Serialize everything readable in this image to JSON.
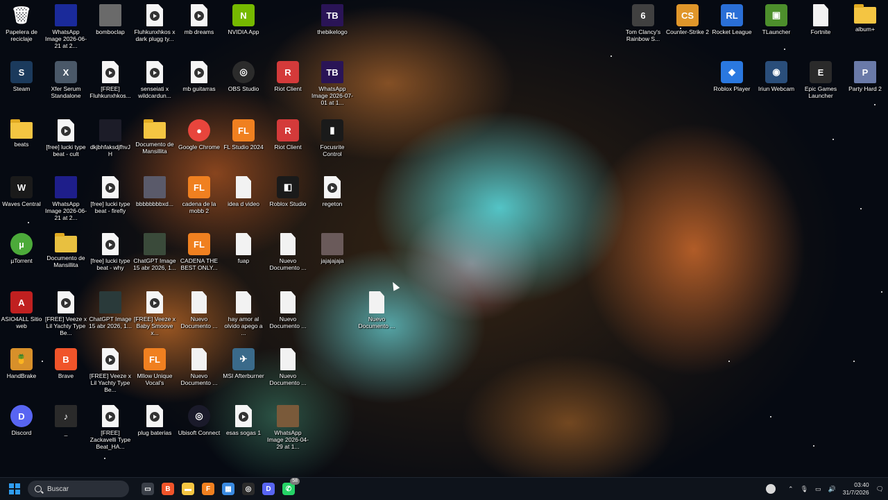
{
  "desktop": {
    "icons": [
      {
        "label": "Papelera de reciclaje",
        "kind": "bin",
        "color": "#cfe3f2",
        "glyph": "🗑"
      },
      {
        "label": "WhatsApp Image 2026-06-21 at 2...",
        "kind": "img",
        "color": "#1a2a9a",
        "glyph": ""
      },
      {
        "label": "bomboclap",
        "kind": "img",
        "color": "#6a6a6a",
        "glyph": ""
      },
      {
        "label": "Fluhkunxhkos x dark plugg ty...",
        "kind": "media",
        "color": "#f5f5f5",
        "glyph": ""
      },
      {
        "label": "mb dreams",
        "kind": "media",
        "color": "#f5f5f5",
        "glyph": ""
      },
      {
        "label": "NVIDIA App",
        "kind": "app",
        "color": "#76b900",
        "glyph": "N"
      },
      {
        "label": "thebikelogo",
        "kind": "img",
        "color": "#2a1456",
        "glyph": "TB"
      },
      {
        "label": "Tom Clancy's Rainbow S...",
        "kind": "app",
        "color": "#404040",
        "glyph": "6"
      },
      {
        "label": "Counter-Strike 2",
        "kind": "app",
        "color": "#e0962a",
        "glyph": "CS"
      },
      {
        "label": "Rocket League",
        "kind": "app",
        "color": "#2a6fd6",
        "glyph": "RL"
      },
      {
        "label": "TLauncher",
        "kind": "app",
        "color": "#4d8f2c",
        "glyph": "▣"
      },
      {
        "label": "Fortnite",
        "kind": "doc",
        "color": "#f2f2f2",
        "glyph": ""
      },
      {
        "label": "album+",
        "kind": "folder",
        "color": "#f4c542",
        "glyph": ""
      },
      {
        "label": "Steam",
        "kind": "app",
        "color": "#1b3a5c",
        "glyph": "S"
      },
      {
        "label": "Xfer Serum Standalone",
        "kind": "app",
        "color": "#4a5868",
        "glyph": "X"
      },
      {
        "label": "[FREE] Fluhkunxhkos...",
        "kind": "media",
        "color": "#f5f5f5",
        "glyph": ""
      },
      {
        "label": "senseiati x wildcardun...",
        "kind": "media",
        "color": "#f5f5f5",
        "glyph": ""
      },
      {
        "label": "mb guitarras",
        "kind": "media",
        "color": "#f5f5f5",
        "glyph": ""
      },
      {
        "label": "OBS Studio",
        "kind": "round",
        "color": "#2b2b2b",
        "glyph": "◎"
      },
      {
        "label": "Riot Client",
        "kind": "app",
        "color": "#d43a3a",
        "glyph": "R"
      },
      {
        "label": "WhatsApp Image 2026-07-01 at 1...",
        "kind": "img",
        "color": "#2a1456",
        "glyph": "TB"
      },
      {
        "label": "Roblox Player",
        "kind": "app",
        "color": "#2a78e0",
        "glyph": "◆"
      },
      {
        "label": "Iriun Webcam",
        "kind": "app",
        "color": "#2a4e7a",
        "glyph": "◉"
      },
      {
        "label": "Epic Games Launcher",
        "kind": "app",
        "color": "#2a2a2a",
        "glyph": "E"
      },
      {
        "label": "Party Hard 2",
        "kind": "img",
        "color": "#6a7aa8",
        "glyph": "P"
      },
      {
        "label": "beats",
        "kind": "folder",
        "color": "#f4c542",
        "glyph": ""
      },
      {
        "label": "[free] lucki type beat - cult",
        "kind": "media",
        "color": "#f5f5f5",
        "glyph": ""
      },
      {
        "label": "dkjbhfaksdjfhvJH",
        "kind": "img",
        "color": "#1c1c28",
        "glyph": ""
      },
      {
        "label": "Documento de Mansillita",
        "kind": "folder",
        "color": "#f4c542",
        "glyph": ""
      },
      {
        "label": "Google Chrome",
        "kind": "round",
        "color": "#e8453c",
        "glyph": "●"
      },
      {
        "label": "FL Studio 2024",
        "kind": "app",
        "color": "#f08020",
        "glyph": "FL"
      },
      {
        "label": "Riot Client",
        "kind": "app",
        "color": "#d43a3a",
        "glyph": "R"
      },
      {
        "label": "Focusrite Control",
        "kind": "app",
        "color": "#1a1a1a",
        "glyph": "▮"
      },
      {
        "label": "Waves Central",
        "kind": "app",
        "color": "#1a1a1a",
        "glyph": "W"
      },
      {
        "label": "WhatsApp Image 2026-06-21 at 2...",
        "kind": "img",
        "color": "#1e1e8a",
        "glyph": ""
      },
      {
        "label": "[free] lucki type beat - firefly",
        "kind": "media",
        "color": "#f5f5f5",
        "glyph": ""
      },
      {
        "label": "bbbbbbbbxd...",
        "kind": "img",
        "color": "#5a5a6a",
        "glyph": ""
      },
      {
        "label": "cadena de la mobb 2",
        "kind": "app",
        "color": "#f08020",
        "glyph": "FL"
      },
      {
        "label": "idea d video",
        "kind": "doc",
        "color": "#f2f2f2",
        "glyph": ""
      },
      {
        "label": "Roblox Studio",
        "kind": "app",
        "color": "#1a1a1a",
        "glyph": "◧"
      },
      {
        "label": "regeton",
        "kind": "media",
        "color": "#f5f5f5",
        "glyph": ""
      },
      {
        "label": "µTorrent",
        "kind": "round",
        "color": "#4caa3a",
        "glyph": "µ"
      },
      {
        "label": "Documento de Mansillita",
        "kind": "folder",
        "color": "#e8c040",
        "glyph": ""
      },
      {
        "label": "[free] lucki type beat - why",
        "kind": "media",
        "color": "#f5f5f5",
        "glyph": ""
      },
      {
        "label": "ChatGPT Image 15 abr 2026, 1...",
        "kind": "img",
        "color": "#3a4a3a",
        "glyph": ""
      },
      {
        "label": "CADENA THE BEST ONLY...",
        "kind": "app",
        "color": "#f08020",
        "glyph": "FL"
      },
      {
        "label": "fuap",
        "kind": "doc",
        "color": "#f2f2f2",
        "glyph": ""
      },
      {
        "label": "Nuevo Documento ...",
        "kind": "doc",
        "color": "#f2f2f2",
        "glyph": ""
      },
      {
        "label": "jajajajaja",
        "kind": "img",
        "color": "#6a5a5a",
        "glyph": ""
      },
      {
        "label": "ASIO4ALL Sitio web",
        "kind": "app",
        "color": "#c02020",
        "glyph": "A"
      },
      {
        "label": "[FREE] Veeze x Lil Yachty Type Be...",
        "kind": "media",
        "color": "#f5f5f5",
        "glyph": ""
      },
      {
        "label": "ChatGPT Image 15 abr 2026, 1...",
        "kind": "img",
        "color": "#2a3a3a",
        "glyph": ""
      },
      {
        "label": "[FREE] Veeze x Baby Smoove x...",
        "kind": "media",
        "color": "#f5f5f5",
        "glyph": ""
      },
      {
        "label": "Nuevo Documento ...",
        "kind": "doc",
        "color": "#f2f2f2",
        "glyph": ""
      },
      {
        "label": "hay amor al olvido apego a ...",
        "kind": "doc",
        "color": "#f2f2f2",
        "glyph": ""
      },
      {
        "label": "Nuevo Documento ...",
        "kind": "doc",
        "color": "#f2f2f2",
        "glyph": ""
      },
      {
        "label": "Nuevo Documento ...",
        "kind": "doc",
        "color": "#f2f2f2",
        "glyph": ""
      },
      {
        "label": "HandBrake",
        "kind": "app",
        "color": "#d8902a",
        "glyph": "🍍"
      },
      {
        "label": "Brave",
        "kind": "app",
        "color": "#f0542a",
        "glyph": "B"
      },
      {
        "label": "[FREE] Veeze x Lil Yachty Type Be...",
        "kind": "media",
        "color": "#f5f5f5",
        "glyph": ""
      },
      {
        "label": "Mllow Unique Vocal's",
        "kind": "app",
        "color": "#f08020",
        "glyph": "FL"
      },
      {
        "label": "Nuevo Documento ...",
        "kind": "doc",
        "color": "#f2f2f2",
        "glyph": ""
      },
      {
        "label": "MSI Afterburner",
        "kind": "app",
        "color": "#3a6a8a",
        "glyph": "✈"
      },
      {
        "label": "Nuevo Documento ...",
        "kind": "doc",
        "color": "#f2f2f2",
        "glyph": ""
      },
      {
        "label": "Discord",
        "kind": "round",
        "color": "#5865f2",
        "glyph": "D"
      },
      {
        "label": "_",
        "kind": "img",
        "color": "#2a2a2a",
        "glyph": "♪"
      },
      {
        "label": "[FREE] Zackavelli Type Beat_HA...",
        "kind": "media",
        "color": "#f5f5f5",
        "glyph": ""
      },
      {
        "label": "plug baterias",
        "kind": "media",
        "color": "#f5f5f5",
        "glyph": ""
      },
      {
        "label": "Ubisoft Connect",
        "kind": "round",
        "color": "#1a1a2a",
        "glyph": "◎"
      },
      {
        "label": "esas sogas 1",
        "kind": "media",
        "color": "#f5f5f5",
        "glyph": ""
      },
      {
        "label": "WhatsApp Image 2026-04-29 at 1...",
        "kind": "img",
        "color": "#7a5a3a",
        "glyph": ""
      }
    ]
  },
  "taskbar": {
    "search_placeholder": "Buscar",
    "whatsapp_badge": "58",
    "time": "03:40",
    "date": "31/7/2026",
    "pinned": [
      {
        "name": "task-view",
        "color": "#3a3f48",
        "glyph": "▭"
      },
      {
        "name": "brave",
        "color": "#f0542a",
        "glyph": "B"
      },
      {
        "name": "file-explorer",
        "color": "#f4c542",
        "glyph": "▬"
      },
      {
        "name": "fl-studio",
        "color": "#f08020",
        "glyph": "F"
      },
      {
        "name": "microsoft-store",
        "color": "#3a8ae0",
        "glyph": "▦"
      },
      {
        "name": "obs",
        "color": "#2b2b2b",
        "glyph": "◎"
      },
      {
        "name": "discord",
        "color": "#5865f2",
        "glyph": "D"
      },
      {
        "name": "whatsapp",
        "color": "#25d366",
        "glyph": "✆"
      }
    ]
  }
}
